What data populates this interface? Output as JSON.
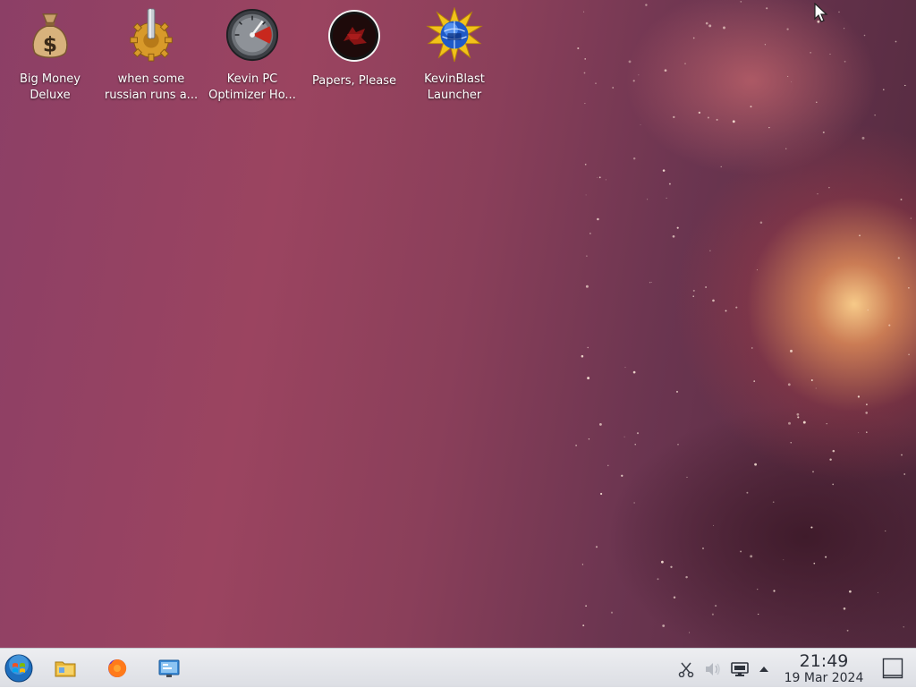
{
  "desktop": {
    "icons": [
      {
        "name": "money-bag-icon",
        "label_line1": "Big Money",
        "label_line2": "Deluxe"
      },
      {
        "name": "gear-icon",
        "label_line1": "when some",
        "label_line2": "russian runs a..."
      },
      {
        "name": "speedometer-icon",
        "label_line1": "Kevin PC",
        "label_line2": "Optimizer Ho..."
      },
      {
        "name": "papers-please-icon",
        "label_line1": "Papers, Please",
        "label_line2": ""
      },
      {
        "name": "globe-burst-icon",
        "label_line1": "KevinBlast",
        "label_line2": "Launcher"
      }
    ]
  },
  "taskbar": {
    "start_icon": "start-orb-icon",
    "pinned": [
      {
        "name": "file-manager-icon"
      },
      {
        "name": "firefox-icon"
      },
      {
        "name": "system-settings-icon"
      }
    ],
    "tray": [
      {
        "name": "scissors-icon"
      },
      {
        "name": "volume-icon"
      },
      {
        "name": "network-display-icon"
      },
      {
        "name": "tray-expand-arrow-icon"
      }
    ],
    "clock": {
      "time": "21:49",
      "date": "19 Mar 2024"
    },
    "show_desktop_icon": "show-desktop-icon"
  }
}
